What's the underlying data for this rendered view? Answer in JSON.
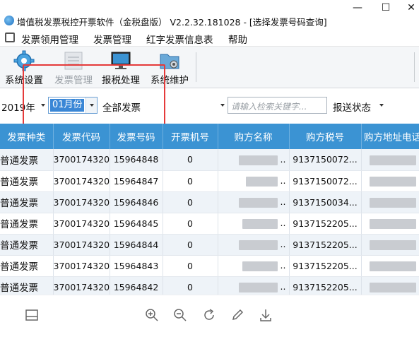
{
  "window": {
    "title": "增值税发票税控开票软件（金税盘版） V2.2.32.181028 - [选择发票号码查询]",
    "minimize_glyph": "—",
    "maximize_glyph": "☐",
    "close_glyph": "✕"
  },
  "menu": {
    "items": [
      "发票领用管理",
      "发票管理",
      "红字发票信息表",
      "帮助"
    ]
  },
  "toolbar": {
    "items": [
      {
        "label": "系统设置",
        "icon": "gear-icon",
        "enabled": true
      },
      {
        "label": "发票管理",
        "icon": "invoice-icon",
        "enabled": false
      },
      {
        "label": "报税处理",
        "icon": "monitor-icon",
        "enabled": true
      },
      {
        "label": "系统维护",
        "icon": "folder-gear-icon",
        "enabled": true
      }
    ]
  },
  "filters": {
    "year": "2019年",
    "month": "01月份",
    "invoice_type": "全部发票",
    "search_placeholder": "请输入检索关键字...",
    "report_status": "报送状态"
  },
  "table": {
    "columns": [
      "发票种类",
      "发票代码",
      "发票号码",
      "开票机号",
      "购方名称",
      "购方税号",
      "购方地址电话"
    ],
    "rows": [
      {
        "type": "普通发票",
        "code": "3700174320",
        "number": "15964848",
        "machine": "0",
        "name": "..",
        "tax_id": "9137150072...",
        "addr": ""
      },
      {
        "type": "普通发票",
        "code": "3700174320",
        "number": "15964847",
        "machine": "0",
        "name": "..",
        "tax_id": "9137150072...",
        "addr": ""
      },
      {
        "type": "普通发票",
        "code": "3700174320",
        "number": "15964846",
        "machine": "0",
        "name": "..",
        "tax_id": "9137150034...",
        "addr": ""
      },
      {
        "type": "普通发票",
        "code": "3700174320",
        "number": "15964845",
        "machine": "0",
        "name": "..",
        "tax_id": "9137152205...",
        "addr": ""
      },
      {
        "type": "普通发票",
        "code": "3700174320",
        "number": "15964844",
        "machine": "0",
        "name": "..",
        "tax_id": "9137152205...",
        "addr": ""
      },
      {
        "type": "普通发票",
        "code": "3700174320",
        "number": "15964843",
        "machine": "0",
        "name": "..",
        "tax_id": "9137152205...",
        "addr": ""
      },
      {
        "type": "普通发票",
        "code": "3700174320",
        "number": "15964842",
        "machine": "0",
        "name": "..",
        "tax_id": "9137152205...",
        "addr": ""
      }
    ]
  },
  "bottom_icons": [
    "layout-icon",
    "zoom-in-icon",
    "zoom-out-icon",
    "refresh-icon",
    "edit-icon",
    "download-icon"
  ],
  "colors": {
    "header_blue": "#3b93d3",
    "highlight_red": "#e53a3a",
    "selected_blue": "#3a87d6"
  }
}
